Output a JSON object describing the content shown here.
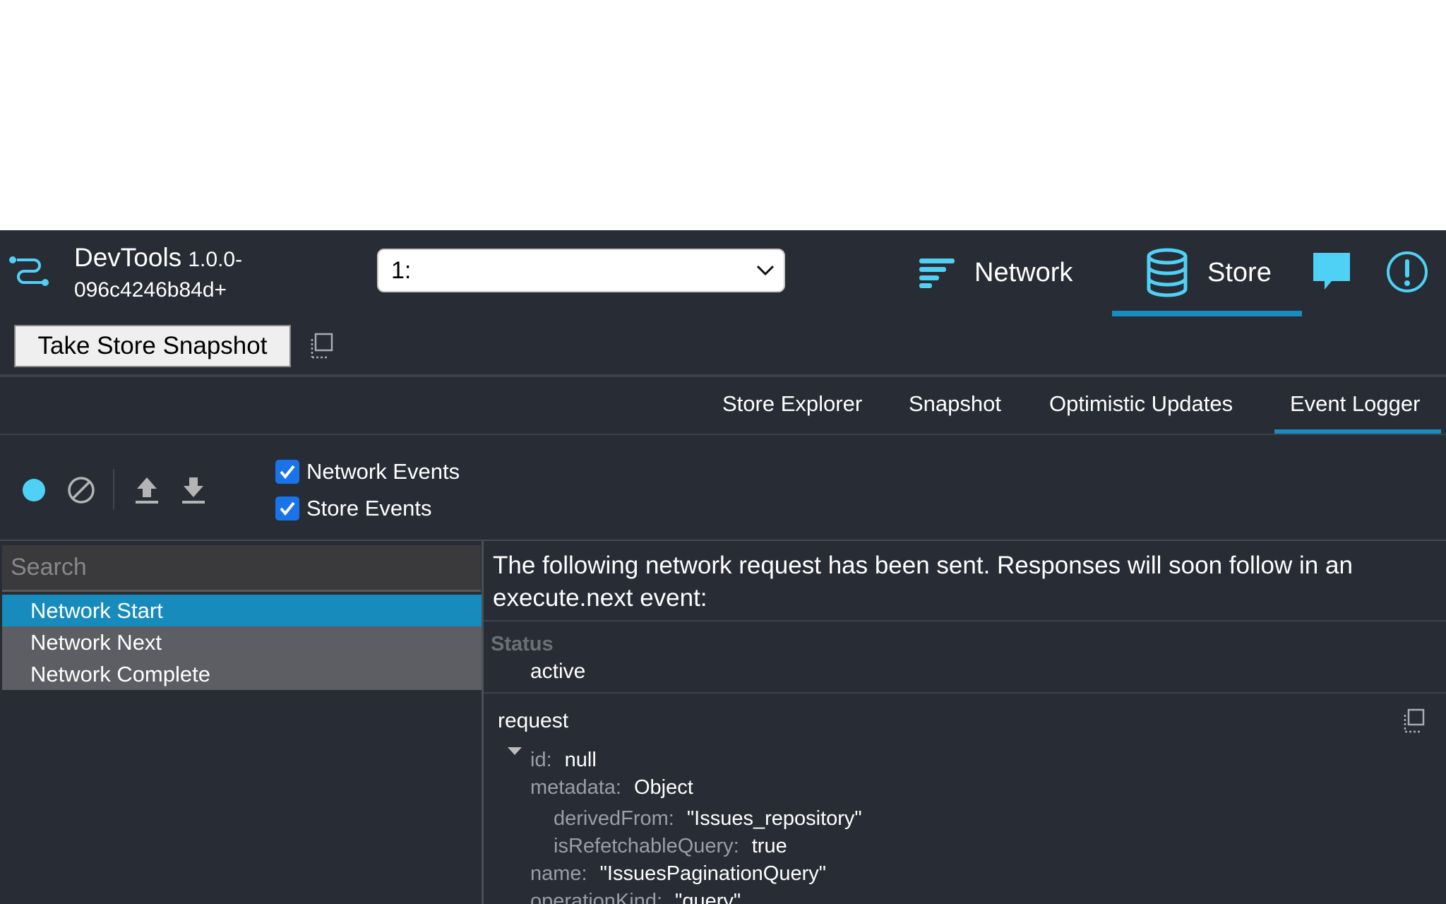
{
  "header": {
    "title_name": "DevTools",
    "title_version_1": "1.0.0-",
    "title_version_2": "096c4246b84d+",
    "env_select": "1:",
    "tabs": [
      {
        "label": "Network",
        "icon": "list-lines-icon"
      },
      {
        "label": "Store",
        "icon": "database-icon",
        "active": true
      }
    ]
  },
  "snapshot": {
    "button_label": "Take Store Snapshot"
  },
  "sub_tabs": [
    "Store Explorer",
    "Snapshot",
    "Optimistic Updates",
    "Event Logger"
  ],
  "toolbar": {
    "checkboxes": [
      {
        "label": "Network Events",
        "checked": true
      },
      {
        "label": "Store Events",
        "checked": true
      }
    ]
  },
  "search": {
    "placeholder": "Search"
  },
  "events": [
    "Network Start",
    "Network Next",
    "Network Complete"
  ],
  "detail": {
    "description": "The following network request has been sent. Responses will soon follow in an execute.next event:",
    "status_label": "Status",
    "status_value": "active",
    "request_label": "request",
    "fields": {
      "id_key": "id",
      "id_val": "null",
      "metadata_key": "metadata",
      "metadata_val": "Object",
      "derived_key": "derivedFrom",
      "derived_val": "\"Issues_repository\"",
      "refetch_key": "isRefetchableQuery",
      "refetch_val": "true",
      "name_key": "name",
      "name_val": "\"IssuesPaginationQuery\"",
      "opkind_key": "operationKind",
      "opkind_val": "\"query\""
    }
  },
  "colors": {
    "background": "#282c34",
    "accent": "#1a8cc0",
    "icon_cyan": "#4fd1f6",
    "selected_row": "#178cbc"
  }
}
